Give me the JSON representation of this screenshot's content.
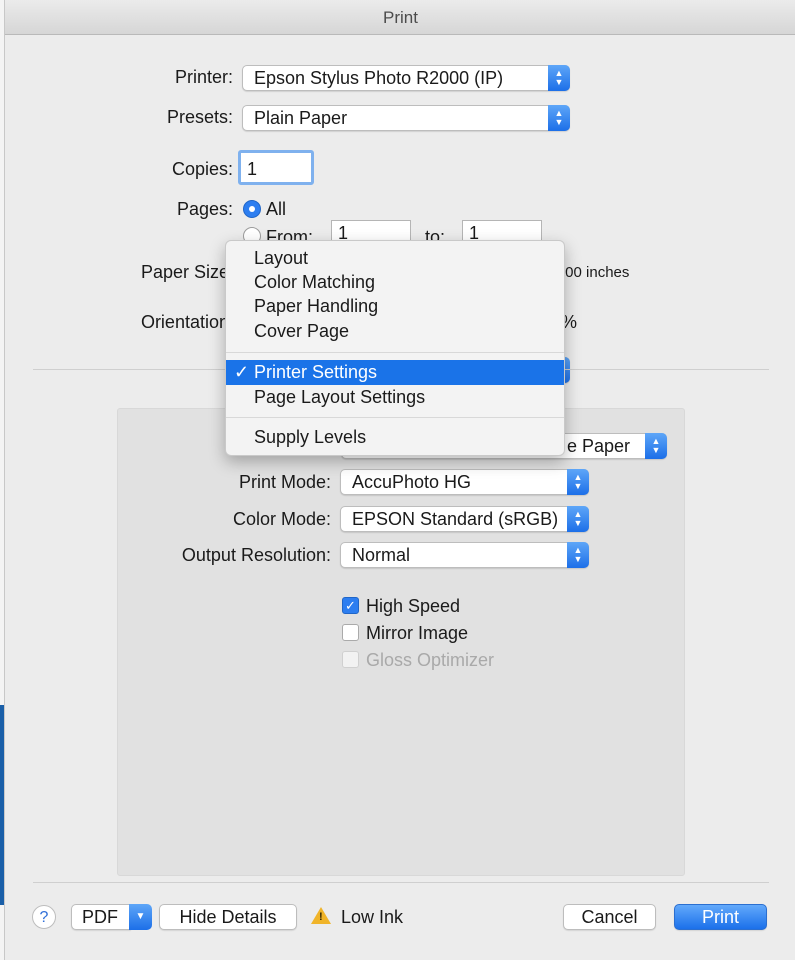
{
  "window": {
    "title": "Print"
  },
  "printer": {
    "label": "Printer:",
    "value": "Epson Stylus Photo R2000 (IP)"
  },
  "presets": {
    "label": "Presets:",
    "value": "Plain Paper"
  },
  "copies": {
    "label": "Copies:",
    "value": "1"
  },
  "pages": {
    "label": "Pages:",
    "all_label": "All",
    "from_label": "From:",
    "from_value": "1",
    "to_label": "to:",
    "to_value": "1"
  },
  "paper_size": {
    "label": "Paper Size",
    "value_fragment": ".00 inches"
  },
  "orientation": {
    "label": "Orientation",
    "scale_fragment": "%"
  },
  "menu": {
    "items": [
      "Layout",
      "Color Matching",
      "Paper Handling",
      "Cover Page",
      "Printer Settings",
      "Page Layout Settings",
      "Supply Levels"
    ],
    "selected": "Printer Settings",
    "check_glyph": "✓"
  },
  "settings": {
    "media_type_fragment": "e Paper",
    "print_mode": {
      "label": "Print Mode:",
      "value": "AccuPhoto HG"
    },
    "color_mode": {
      "label": "Color Mode:",
      "value": "EPSON Standard (sRGB)"
    },
    "output_resolution": {
      "label": "Output Resolution:",
      "value": "Normal"
    },
    "high_speed": {
      "label": "High Speed",
      "checked": true
    },
    "mirror_image": {
      "label": "Mirror Image",
      "checked": false
    },
    "gloss_optimizer": {
      "label": "Gloss Optimizer",
      "checked": false,
      "enabled": false
    }
  },
  "footer": {
    "help_glyph": "?",
    "pdf_label": "PDF",
    "hide_details_label": "Hide Details",
    "warning_text": "Low Ink",
    "cancel_label": "Cancel",
    "print_label": "Print"
  },
  "colors": {
    "accent": "#1a73e8",
    "dialog_bg": "#ececec",
    "panel_bg": "#e1e1e1"
  }
}
